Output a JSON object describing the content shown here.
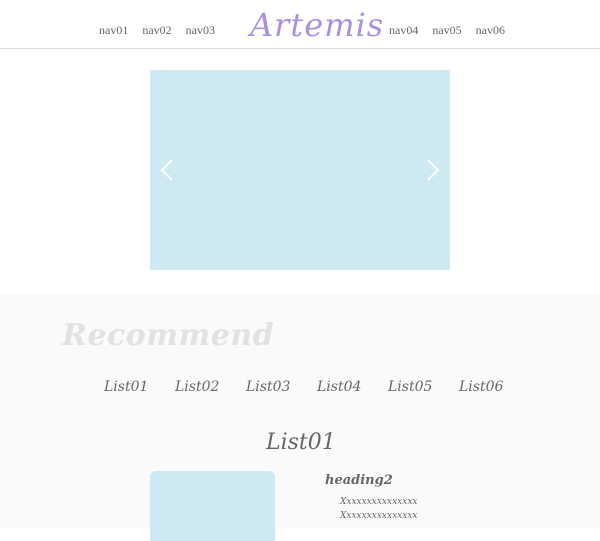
{
  "header": {
    "logo": "Artemis",
    "nav_left": [
      "nav01",
      "nav02",
      "nav03"
    ],
    "nav_right": [
      "nav04",
      "nav05",
      "nav06"
    ]
  },
  "slider": {
    "prev_icon": "chevron-left-icon",
    "next_icon": "chevron-right-icon",
    "color": "#cdeaf2"
  },
  "recommend": {
    "title": "Recommend",
    "tabs": [
      "List01",
      "List02",
      "List03",
      "List04",
      "List05",
      "List06"
    ],
    "active_heading": "List01",
    "item": {
      "heading": "heading2",
      "lines": [
        "Xxxxxxxxxxxxxxx",
        "Xxxxxxxxxxxxxxx"
      ]
    }
  },
  "colors": {
    "accent_logo": "#ab8fe0",
    "text": "#666666",
    "section_bg": "#fafafa",
    "placeholder": "#cdeaf2"
  }
}
